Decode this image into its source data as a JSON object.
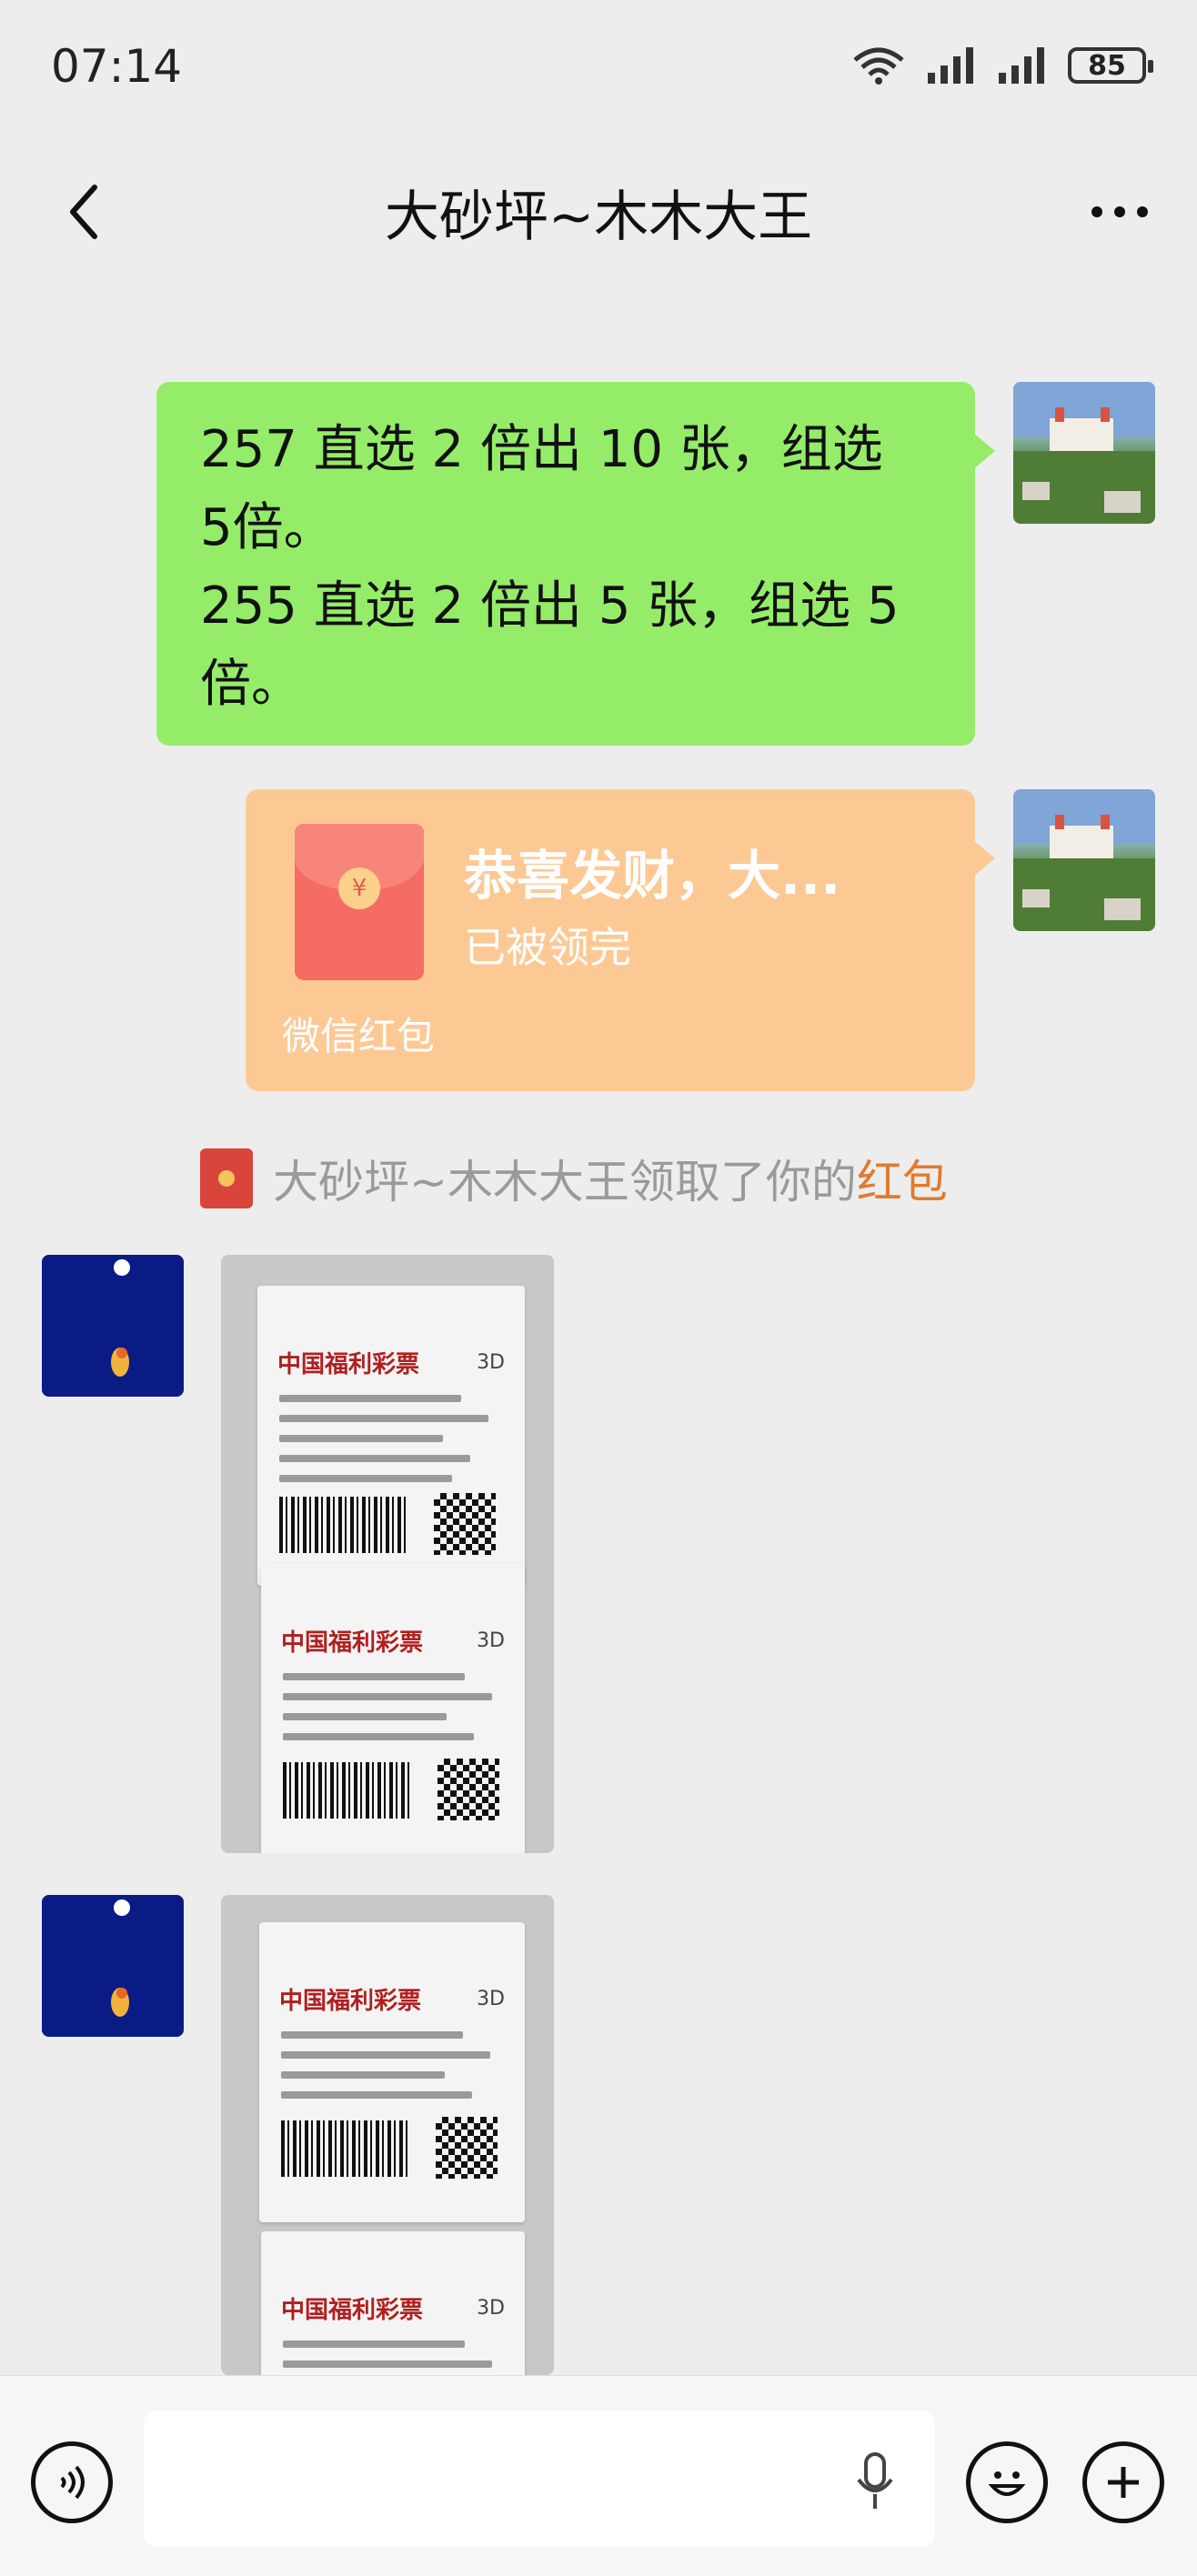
{
  "status_bar": {
    "time": "07:14",
    "battery": "85"
  },
  "header": {
    "title": "大砂坪~木木大王"
  },
  "messages": {
    "text_bubble": {
      "line1": "257 直选 2 倍出 10 张，组选",
      "line2": "5倍。",
      "line3": "255 直选 2 倍出 5 张，组选 5",
      "line4": "倍。"
    },
    "red_packet": {
      "title": "恭喜发财，大...",
      "status": "已被领完",
      "label": "微信红包"
    },
    "system_notice": {
      "text": "大砂坪~木木大王领取了你的",
      "link": "红包"
    },
    "photos": [
      {
        "receipt_brand": "中国福利彩票",
        "game": "3D"
      },
      {
        "receipt_brand": "中国福利彩票",
        "game": "3D"
      }
    ]
  },
  "colors": {
    "sent_bubble": "#95ec69",
    "red_packet_opened": "#fcc995",
    "link": "#e27a2e",
    "background": "#ededed"
  }
}
